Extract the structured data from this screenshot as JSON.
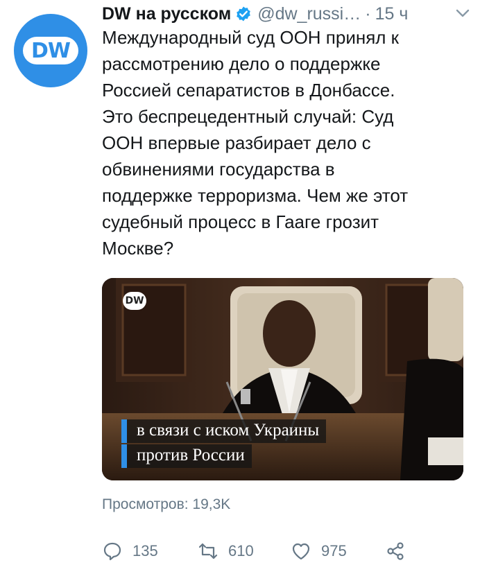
{
  "account": {
    "name": "DW на русском",
    "handle": "@dw_russi…",
    "separator": "·",
    "time": "15 ч",
    "avatar_text": "DW"
  },
  "tweet": {
    "lines": [
      "Международный суд ООН принял к",
      "рассмотрению дело о поддержке",
      "Россией сепаратистов в Донбассе.",
      "Это беспрецедентный случай: Суд",
      "ООН впервые разбирает дело с",
      "обвинениями государства в",
      "поддержке терроризма. Чем же этот",
      "судебный процесс в Гааге грозит",
      "Москве?"
    ]
  },
  "media": {
    "logo_text": "DW",
    "subtitle_lines": [
      "в связи с иском Украины",
      "против России"
    ]
  },
  "views": "Просмотров: 19,3K",
  "actions": {
    "reply_count": "135",
    "retweet_count": "610",
    "like_count": "975"
  },
  "colors": {
    "accent": "#2f8fe6",
    "muted": "#657786",
    "verified": "#1da1f2"
  }
}
